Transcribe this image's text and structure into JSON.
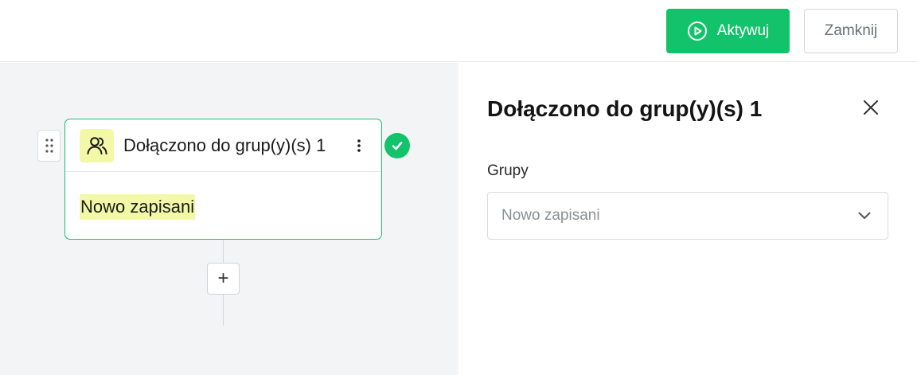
{
  "toolbar": {
    "activate_label": "Aktywuj",
    "activate_icon": "play-circle-icon",
    "close_label": "Zamknij",
    "accent_color": "#13c36b"
  },
  "canvas": {
    "node": {
      "title": "Dołączono do grup(y)(s) 1",
      "icon": "users-icon",
      "tag": "Nowo zapisani",
      "status": "check-icon",
      "highlight_color": "#f3f8a6"
    },
    "add_label": "+"
  },
  "panel": {
    "title": "Dołączono do grup(y)(s) 1",
    "field_label": "Grupy",
    "select_value": "Nowo zapisani"
  }
}
